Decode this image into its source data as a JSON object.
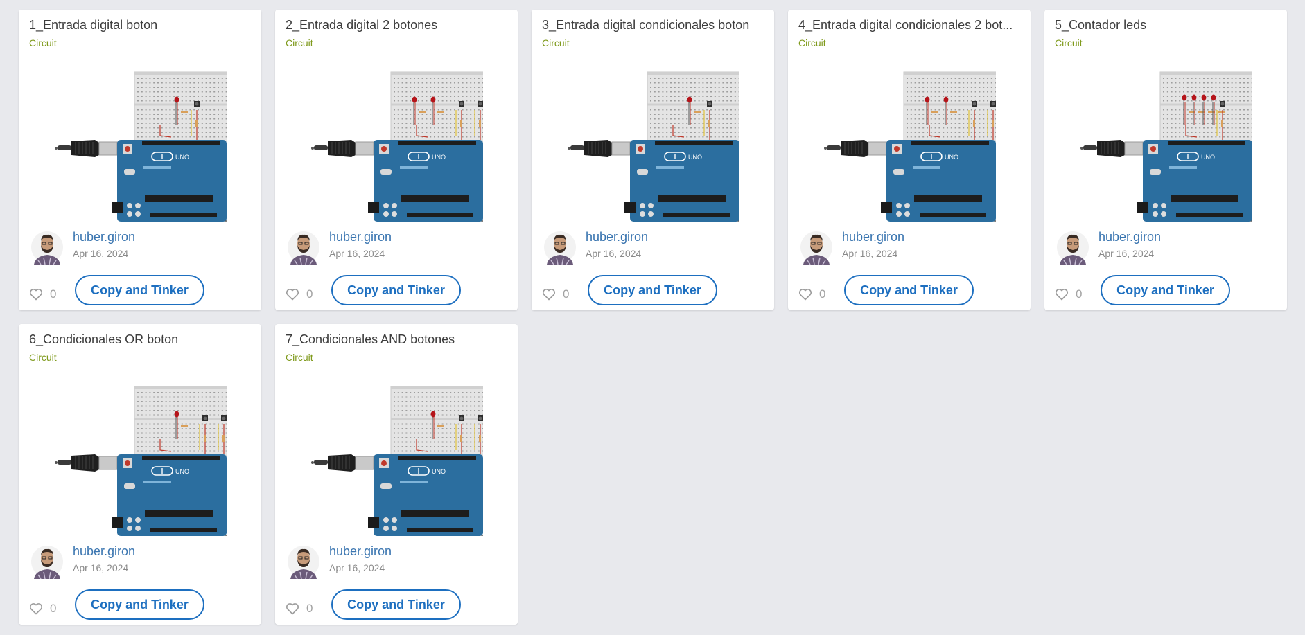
{
  "cards": [
    {
      "title": "1_Entrada digital boton",
      "type": "Circuit",
      "author": "huber.giron",
      "date": "Apr 16, 2024",
      "likes": "0",
      "button": "Copy and Tinker",
      "leds": 1,
      "buttons": 1
    },
    {
      "title": "2_Entrada digital 2 botones",
      "type": "Circuit",
      "author": "huber.giron",
      "date": "Apr 16, 2024",
      "likes": "0",
      "button": "Copy and Tinker",
      "leds": 2,
      "buttons": 2
    },
    {
      "title": "3_Entrada digital condicionales boton",
      "type": "Circuit",
      "author": "huber.giron",
      "date": "Apr 16, 2024",
      "likes": "0",
      "button": "Copy and Tinker",
      "leds": 1,
      "buttons": 1
    },
    {
      "title": "4_Entrada digital condicionales 2 bot...",
      "type": "Circuit",
      "author": "huber.giron",
      "date": "Apr 16, 2024",
      "likes": "0",
      "button": "Copy and Tinker",
      "leds": 2,
      "buttons": 2
    },
    {
      "title": "5_Contador leds",
      "type": "Circuit",
      "author": "huber.giron",
      "date": "Apr 16, 2024",
      "likes": "0",
      "button": "Copy and Tinker",
      "leds": 4,
      "buttons": 1
    },
    {
      "title": "6_Condicionales OR boton",
      "type": "Circuit",
      "author": "huber.giron",
      "date": "Apr 16, 2024",
      "likes": "0",
      "button": "Copy and Tinker",
      "leds": 1,
      "buttons": 2
    },
    {
      "title": "7_Condicionales AND botones",
      "type": "Circuit",
      "author": "huber.giron",
      "date": "Apr 16, 2024",
      "likes": "0",
      "button": "Copy and Tinker",
      "leds": 1,
      "buttons": 2
    }
  ],
  "colors": {
    "background": "#e8e9ed",
    "card": "#ffffff",
    "type_label": "#7f9a1c",
    "author_link": "#3a75b0",
    "button_accent": "#1d6fc0",
    "arduino_board": "#2b6e9f",
    "led": "#b5141a"
  },
  "icons": {
    "like": "heart-outline-icon",
    "thumbnail": "arduino-breadboard-circuit",
    "avatar": "user-avatar"
  }
}
